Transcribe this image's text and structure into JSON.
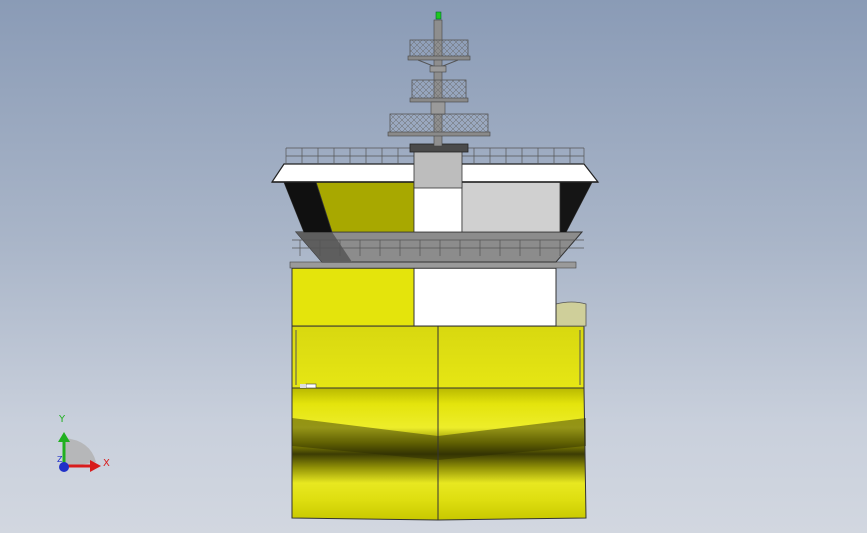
{
  "viewport": {
    "background_top": "#8a9bb6",
    "background_bottom": "#d2d7e0"
  },
  "model": {
    "hull_color": "#e4e40c",
    "hull_shadow_color": "#3c3c04",
    "superstructure_white": "#ffffff",
    "wheelhouse_yellow": "#a8a800",
    "wheelhouse_grey": "#cfcfcf",
    "mast_light_color": "#1ec81e"
  },
  "triad": {
    "x_label": "X",
    "y_label": "Y",
    "z_label": "Z",
    "x_color": "#d81c1c",
    "y_color": "#20b020",
    "z_color": "#2030c8"
  }
}
